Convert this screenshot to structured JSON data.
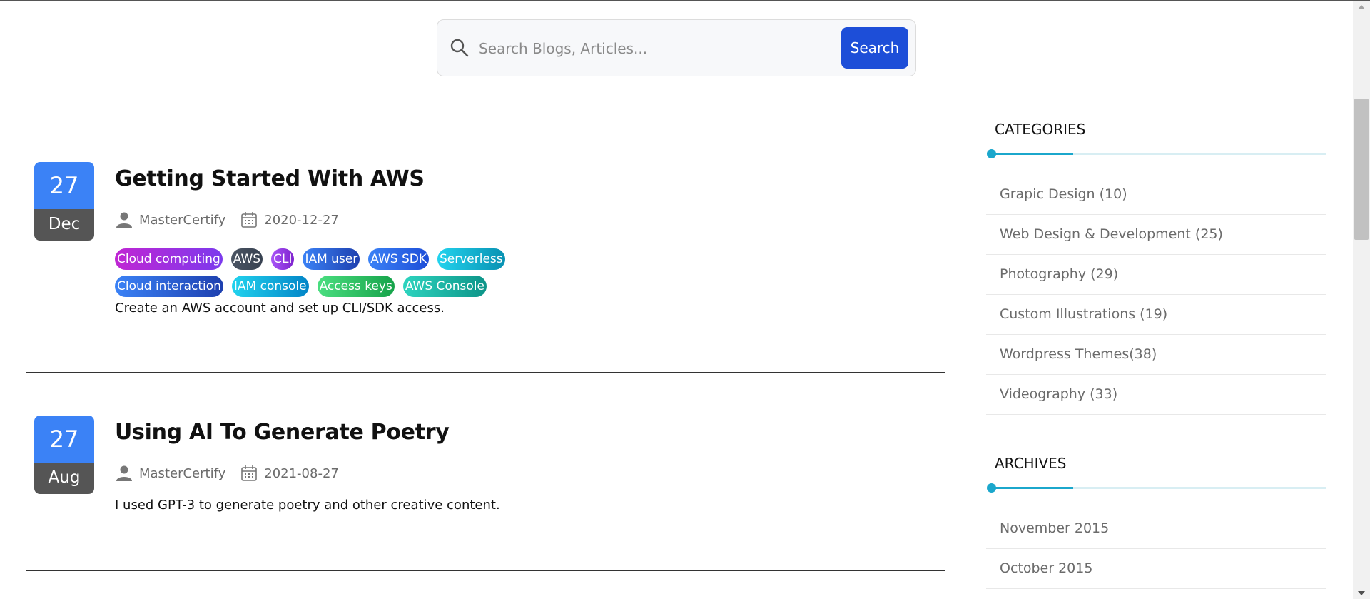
{
  "search": {
    "placeholder": "Search Blogs, Articles...",
    "button_label": "Search",
    "icon": "search-icon"
  },
  "posts": [
    {
      "day": "27",
      "month": "Dec",
      "title": "Getting Started With AWS",
      "author": "MasterCertify",
      "date": "2020-12-27",
      "tags": [
        {
          "label": "Cloud computing",
          "gradient": [
            "#c026d3",
            "#7c3aed"
          ]
        },
        {
          "label": "AWS",
          "gradient": [
            "#4b5563",
            "#374151"
          ]
        },
        {
          "label": "CLI",
          "gradient": [
            "#a855f7",
            "#7e22ce"
          ]
        },
        {
          "label": "IAM user",
          "gradient": [
            "#3b82f6",
            "#1e40af"
          ]
        },
        {
          "label": "AWS SDK",
          "gradient": [
            "#3b82f6",
            "#1d4ed8"
          ]
        },
        {
          "label": "Serverless",
          "gradient": [
            "#22d3ee",
            "#0891b2"
          ]
        },
        {
          "label": "Cloud interaction",
          "gradient": [
            "#3b82f6",
            "#1e40af"
          ]
        },
        {
          "label": "IAM console",
          "gradient": [
            "#22d3ee",
            "#0284c7"
          ]
        },
        {
          "label": "Access keys",
          "gradient": [
            "#4ade80",
            "#16a34a"
          ]
        },
        {
          "label": "AWS Console",
          "gradient": [
            "#2dd4bf",
            "#0d9488"
          ]
        }
      ],
      "excerpt": "Create an AWS account and set up CLI/SDK access."
    },
    {
      "day": "27",
      "month": "Aug",
      "title": "Using AI To Generate Poetry",
      "author": "MasterCertify",
      "date": "2021-08-27",
      "tags": [],
      "excerpt": "I used GPT-3 to generate poetry and other creative content."
    }
  ],
  "sidebar": {
    "categories": {
      "title": "CATEGORIES",
      "items": [
        "Grapic Design (10)",
        "Web Design & Development (25)",
        "Photography (29)",
        "Custom Illustrations (19)",
        "Wordpress Themes(38)",
        "Videography (33)"
      ]
    },
    "archives": {
      "title": "ARCHIVES",
      "items": [
        "November 2015",
        "October 2015"
      ]
    }
  },
  "colors": {
    "accent": "#1d4ed8",
    "date_top": "#3b82f6",
    "date_bottom": "#555555",
    "widget_accent": "#1ba7cc"
  }
}
